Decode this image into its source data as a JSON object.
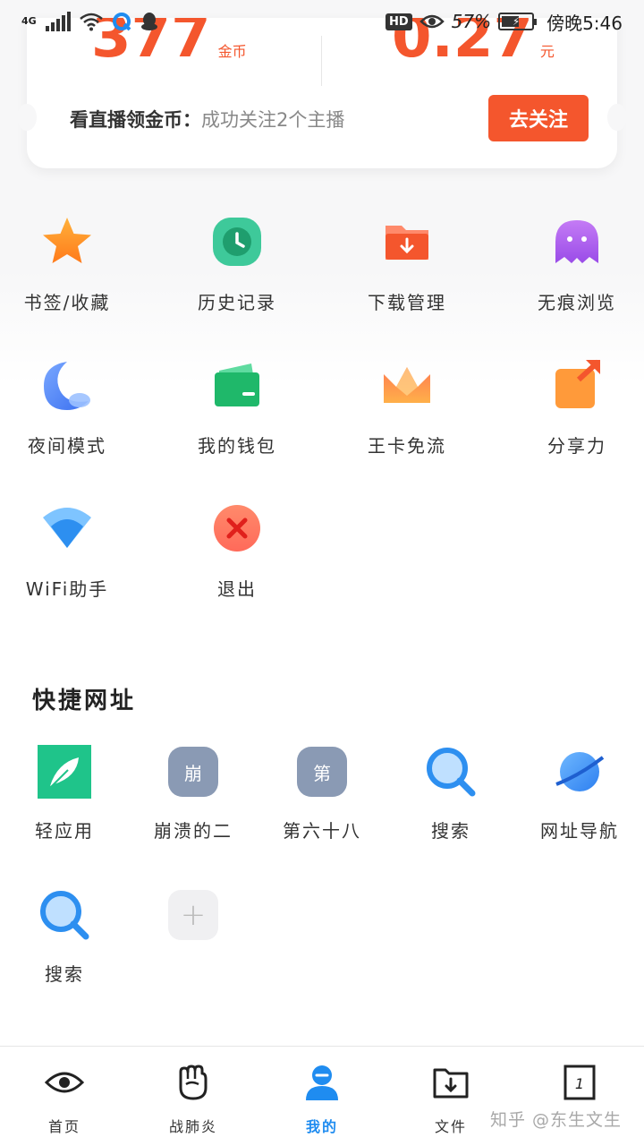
{
  "status_bar": {
    "network": "4G",
    "battery": "57%",
    "time": "傍晚5:46",
    "hd": "HD"
  },
  "card": {
    "coins_value": "377",
    "coins_unit": "金币",
    "cash_value": "0.27",
    "cash_unit": "元",
    "task_label": "看直播领金币：",
    "task_desc": "成功关注2个主播",
    "follow_button": "去关注"
  },
  "features": [
    {
      "label": "书签/收藏",
      "icon": "star-icon"
    },
    {
      "label": "历史记录",
      "icon": "clock-icon"
    },
    {
      "label": "下载管理",
      "icon": "download-folder-icon"
    },
    {
      "label": "无痕浏览",
      "icon": "ghost-icon"
    },
    {
      "label": "夜间模式",
      "icon": "moon-icon"
    },
    {
      "label": "我的钱包",
      "icon": "wallet-icon"
    },
    {
      "label": "王卡免流",
      "icon": "crown-icon"
    },
    {
      "label": "分享力",
      "icon": "share-icon"
    },
    {
      "label": "WiFi助手",
      "icon": "wifi-icon"
    },
    {
      "label": "退出",
      "icon": "close-icon"
    }
  ],
  "quick_links": {
    "title": "快捷网址",
    "items": [
      {
        "label": "轻应用",
        "icon": "feather-icon"
      },
      {
        "label": "崩溃的二",
        "letter": "崩"
      },
      {
        "label": "第六十八",
        "letter": "第"
      },
      {
        "label": "搜索",
        "icon": "search-icon"
      },
      {
        "label": "网址导航",
        "icon": "planet-icon"
      },
      {
        "label": "搜索",
        "icon": "search-icon"
      }
    ],
    "add_symbol": "+"
  },
  "bottom_nav": [
    {
      "label": "首页",
      "icon": "eye-icon"
    },
    {
      "label": "战肺炎",
      "icon": "fist-icon"
    },
    {
      "label": "我的",
      "icon": "user-icon",
      "active": true
    },
    {
      "label": "文件",
      "icon": "file-download-icon"
    },
    {
      "label": "",
      "icon": "tab-count-icon",
      "badge": "1"
    }
  ],
  "watermark": "知乎 @东生文生",
  "colors": {
    "accent_orange": "#f4562d",
    "active_blue": "#1f8cf0"
  }
}
